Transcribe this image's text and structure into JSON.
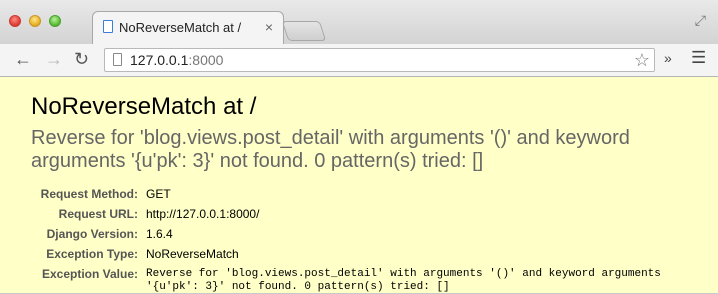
{
  "browser": {
    "tab_title": "NoReverseMatch at /",
    "tab_close": "×",
    "url_host": "127.0.0.1",
    "url_port": ":8000"
  },
  "icons": {
    "back": "arrow-left-icon",
    "forward": "arrow-right-icon",
    "reload": "reload-icon",
    "star": "star-icon",
    "menu": "hamburger-menu-icon",
    "extensions": "double-chevron-icon",
    "fullscreen": "fullscreen-icon"
  },
  "page": {
    "title": "NoReverseMatch at /",
    "exception_message": "Reverse for 'blog.views.post_detail' with arguments '()' and keyword arguments '{u'pk': 3}' not found. 0 pattern(s) tried: []",
    "meta": [
      {
        "label": "Request Method:",
        "value": "GET"
      },
      {
        "label": "Request URL:",
        "value": "http://127.0.0.1:8000/"
      },
      {
        "label": "Django Version:",
        "value": "1.6.4"
      },
      {
        "label": "Exception Type:",
        "value": "NoReverseMatch"
      },
      {
        "label": "Exception Value:",
        "value": "Reverse for 'blog.views.post_detail' with arguments '()' and keyword arguments '{u'pk': 3}' not found. 0 pattern(s) tried: []"
      }
    ]
  },
  "colors": {
    "page_background": "#ffffc8",
    "message_text": "#666666"
  }
}
